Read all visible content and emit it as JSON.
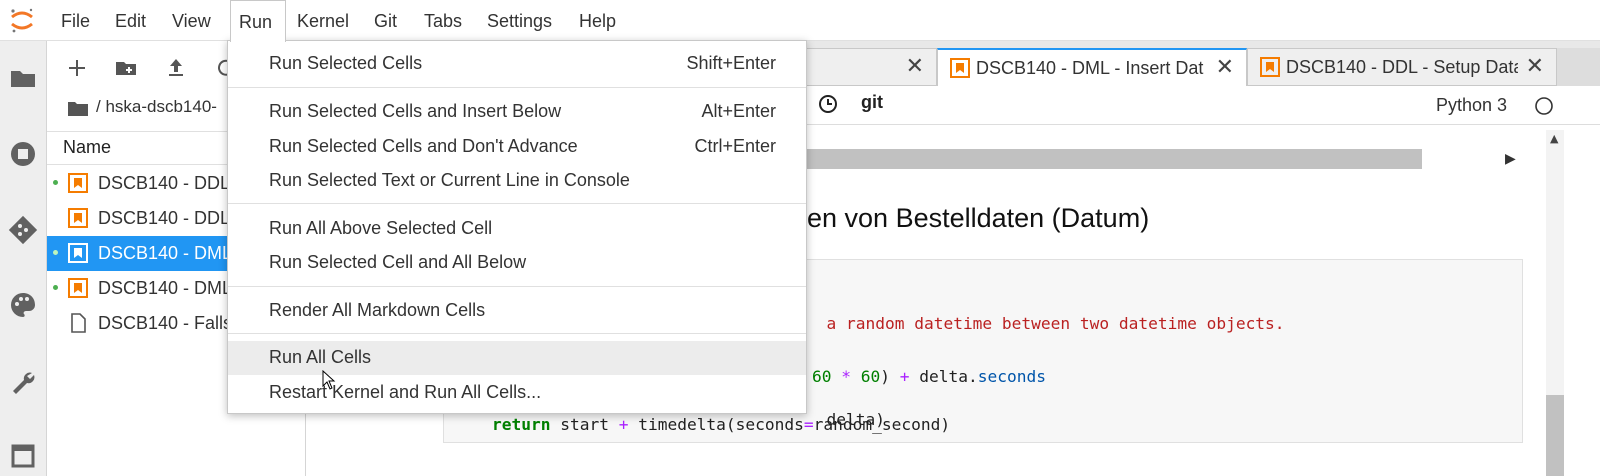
{
  "menubar": {
    "items": [
      "File",
      "Edit",
      "View",
      "Run",
      "Kernel",
      "Git",
      "Tabs",
      "Settings",
      "Help"
    ]
  },
  "filebrowser": {
    "breadcrumb": "/ hska-dscb140-",
    "column_name": "Name",
    "files": [
      {
        "name": "DSCB140 - DDL",
        "running": true,
        "type": "notebook"
      },
      {
        "name": "DSCB140 - DDL",
        "running": false,
        "type": "notebook"
      },
      {
        "name": "DSCB140 - DML",
        "running": true,
        "type": "notebook",
        "selected": true
      },
      {
        "name": "DSCB140 - DML",
        "running": true,
        "type": "notebook"
      },
      {
        "name": "DSCB140 - Falls",
        "running": false,
        "type": "file"
      }
    ]
  },
  "tabs": [
    {
      "label": "DSCB140 - DML - Insert Dat",
      "active": true
    },
    {
      "label": "DSCB140 - DDL - Setup Data",
      "active": false
    }
  ],
  "toolbar": {
    "git_label": "git",
    "kernel_name": "Python 3"
  },
  "notebook": {
    "heading": "en von Bestelldaten (Datum)",
    "code": {
      "line1_str": "a random datetime between two datetime objects.",
      "line2_num1": "60",
      "line2_op1": "*",
      "line2_num2": "60",
      "line2_paren": ")",
      "line2_op2": "+",
      "line2_rest": " delta.",
      "line2_attr": "seconds",
      "line3": "delta)",
      "line4_kw": "return",
      "line4_a": " start ",
      "line4_op": "+",
      "line4_b": " timedelta(seconds",
      "line4_eq": "=",
      "line4_c": "random_second)"
    }
  },
  "run_menu": {
    "items": [
      {
        "label": "Run Selected Cells",
        "shortcut": "Shift+Enter"
      },
      {
        "label": "Run Selected Cells and Insert Below",
        "shortcut": "Alt+Enter"
      },
      {
        "label": "Run Selected Cells and Don't Advance",
        "shortcut": "Ctrl+Enter"
      },
      {
        "label": "Run Selected Text or Current Line in Console",
        "shortcut": ""
      },
      {
        "label": "Run All Above Selected Cell",
        "shortcut": ""
      },
      {
        "label": "Run Selected Cell and All Below",
        "shortcut": ""
      },
      {
        "label": "Render All Markdown Cells",
        "shortcut": ""
      },
      {
        "label": "Run All Cells",
        "shortcut": "",
        "hovered": true
      },
      {
        "label": "Restart Kernel and Run All Cells...",
        "shortcut": ""
      }
    ]
  },
  "colors": {
    "accent": "#2196f3",
    "logo": "#f37726",
    "notebook_icon": "#f57c00",
    "running_dot": "#4caf50"
  }
}
